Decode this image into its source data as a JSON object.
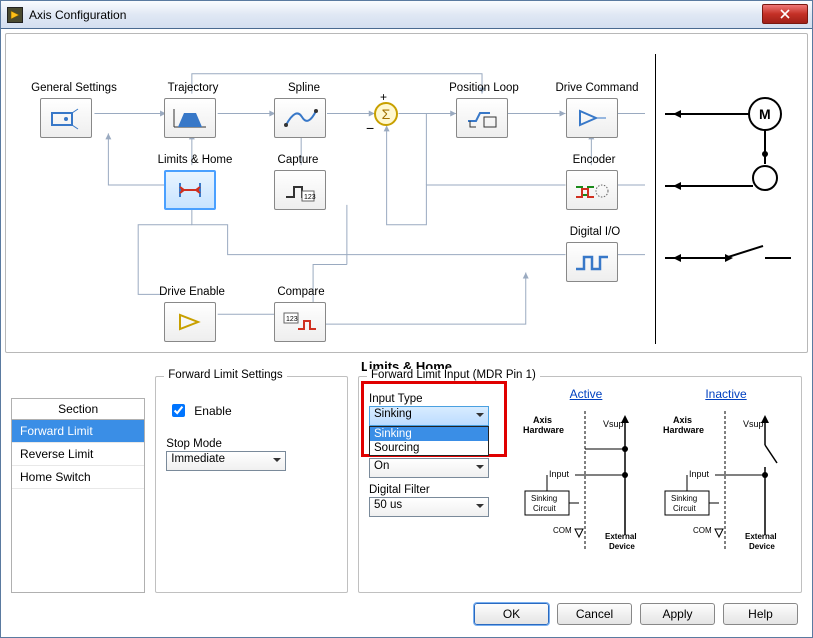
{
  "window": {
    "title": "Axis Configuration"
  },
  "nodes": {
    "general_settings": "General Settings",
    "trajectory": "Trajectory",
    "spline": "Spline",
    "position_loop": "Position Loop",
    "drive_command": "Drive Command",
    "limits_home": "Limits & Home",
    "capture": "Capture",
    "encoder": "Encoder",
    "digital_io": "Digital I/O",
    "drive_enable": "Drive Enable",
    "compare": "Compare"
  },
  "sum_labels": {
    "plus": "+",
    "minus": "−"
  },
  "motor_label": "M",
  "section": {
    "header": "Section",
    "items": [
      "Forward Limit",
      "Reverse Limit",
      "Home Switch"
    ],
    "selected_index": 0
  },
  "page": {
    "title": "Limits & Home",
    "fls": {
      "legend": "Forward Limit Settings",
      "enable_label": "Enable",
      "enable_checked": true,
      "stop_mode_label": "Stop Mode",
      "stop_mode_value": "Immediate"
    },
    "fli": {
      "legend": "Forward Limit Input (MDR Pin 1)",
      "input_type_label": "Input Type",
      "input_type_value": "Sinking",
      "input_type_options": [
        "Sinking",
        "Sourcing"
      ],
      "active_state_value": "On",
      "digital_filter_label": "Digital Filter",
      "digital_filter_value": "50 us",
      "diagram": {
        "active": "Active",
        "inactive": "Inactive",
        "axis_hardware": "Axis Hardware",
        "vsup": "Vsup",
        "input": "Input",
        "sinking_circuit": "Sinking Circuit",
        "com": "COM",
        "external_device": "External Device"
      }
    }
  },
  "buttons": {
    "ok": "OK",
    "cancel": "Cancel",
    "apply": "Apply",
    "help": "Help"
  }
}
